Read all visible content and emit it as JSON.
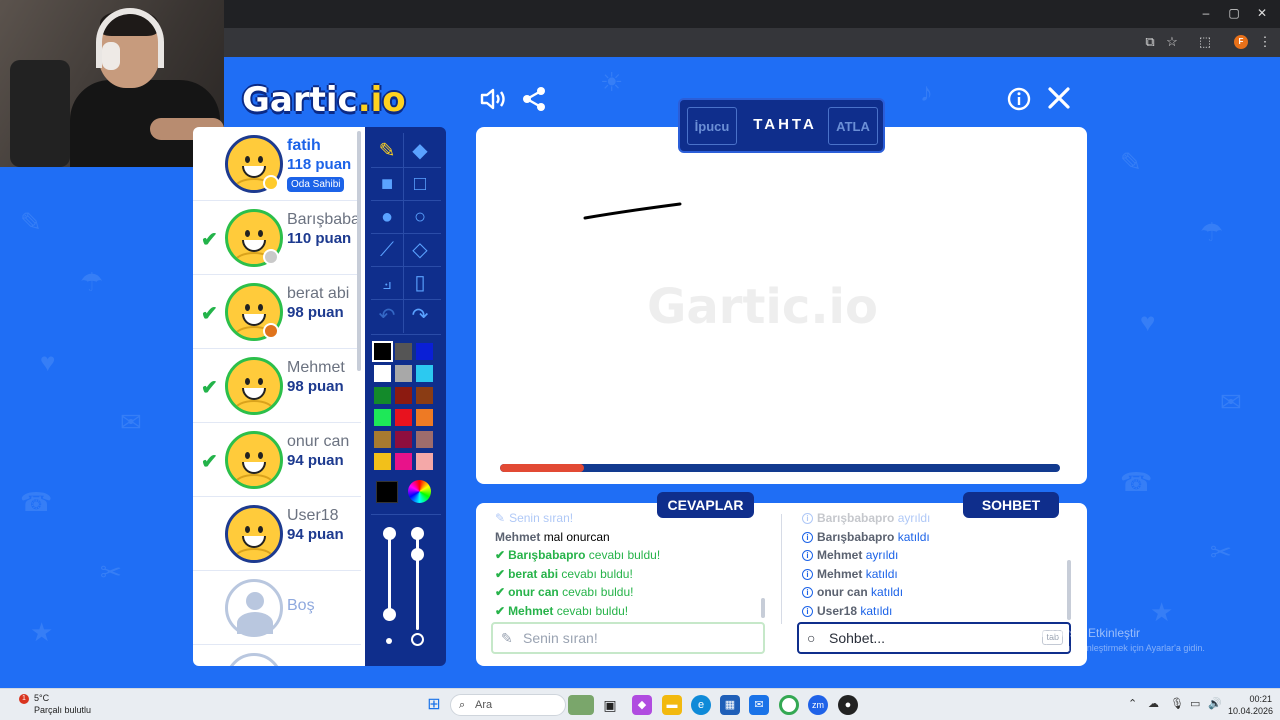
{
  "app": {
    "logo_main": "Gartic",
    "logo_suffix": ".io",
    "canvas_watermark": "Gartic.io"
  },
  "header": {
    "sound_icon": "speaker-icon",
    "share_icon": "share-icon",
    "info_icon": "info-icon",
    "close_icon": "close-icon"
  },
  "board": {
    "hint_label": "İpucu",
    "title": "TAHTA",
    "skip_label": "ATLA",
    "progress_percent": 15
  },
  "players": [
    {
      "name": "fatih",
      "score": "118 puan",
      "me": true,
      "guessed": false,
      "badge": "Oda Sahibi",
      "status_color": "#ffcb2b"
    },
    {
      "name": "Barışbabapro",
      "score": "110 puan",
      "me": false,
      "guessed": true,
      "status_color": "#c9c9c9"
    },
    {
      "name": "berat abi",
      "score": "98 puan",
      "me": false,
      "guessed": true,
      "status_color": "#e0731c"
    },
    {
      "name": "Mehmet",
      "score": "98 puan",
      "me": false,
      "guessed": true,
      "status_color": ""
    },
    {
      "name": "onur can",
      "score": "94 puan",
      "me": false,
      "guessed": true,
      "status_color": ""
    },
    {
      "name": "User18",
      "score": "94 puan",
      "me": false,
      "guessed": false,
      "status_color": ""
    }
  ],
  "empty_slot": {
    "label": "Boş"
  },
  "palette": {
    "colors": [
      "#000000",
      "#555555",
      "#0a1fd6",
      "#ffffff",
      "#a8a8a8",
      "#2cc9f0",
      "#138a2a",
      "#8c1a10",
      "#8a3c14",
      "#1ee858",
      "#e8121e",
      "#ee7a24",
      "#a87a30",
      "#8e0e3e",
      "#9e6c6c",
      "#f2c01a",
      "#e8128a",
      "#f4a8a8"
    ],
    "selected_index": 0,
    "current_color": "#000000"
  },
  "answers": {
    "tag": "CEVAPLAR",
    "messages": [
      {
        "who": "",
        "text": "Senin sıran!",
        "type": "faded"
      },
      {
        "who": "Mehmet",
        "text": "mal onurcan",
        "type": "plain"
      },
      {
        "who": "Barışbabapro",
        "text": "cevabı buldu!",
        "type": "correct"
      },
      {
        "who": "berat abi",
        "text": "cevabı buldu!",
        "type": "correct"
      },
      {
        "who": "onur can",
        "text": "cevabı buldu!",
        "type": "correct"
      },
      {
        "who": "Mehmet",
        "text": "cevabı buldu!",
        "type": "correct"
      }
    ],
    "input_placeholder": "Senin sıran!"
  },
  "chat": {
    "tag": "SOHBET",
    "messages": [
      {
        "who": "Barışbabapro",
        "text": "ayrıldı",
        "type": "faded"
      },
      {
        "who": "Barışbabapro",
        "text": "katıldı",
        "type": "info"
      },
      {
        "who": "Mehmet",
        "text": "ayrıldı",
        "type": "info"
      },
      {
        "who": "Mehmet",
        "text": "katıldı",
        "type": "info"
      },
      {
        "who": "onur can",
        "text": "katıldı",
        "type": "info"
      },
      {
        "who": "User18",
        "text": "katıldı",
        "type": "info"
      }
    ],
    "input_placeholder": "Sohbet...",
    "tab_hint": "tab"
  },
  "windows_activate": {
    "line1": "Windows'u Etkinleştir",
    "line2": "Windows'u etkinleştirmek için Ayarlar'a gidin."
  },
  "taskbar": {
    "weather_temp": "5°C",
    "weather_desc": "Parçalı bulutlu",
    "weather_badge": "1",
    "search_label": "Ara",
    "time": "00:21",
    "date": "10.04.2026"
  },
  "browser": {
    "profile_initial": "F"
  }
}
